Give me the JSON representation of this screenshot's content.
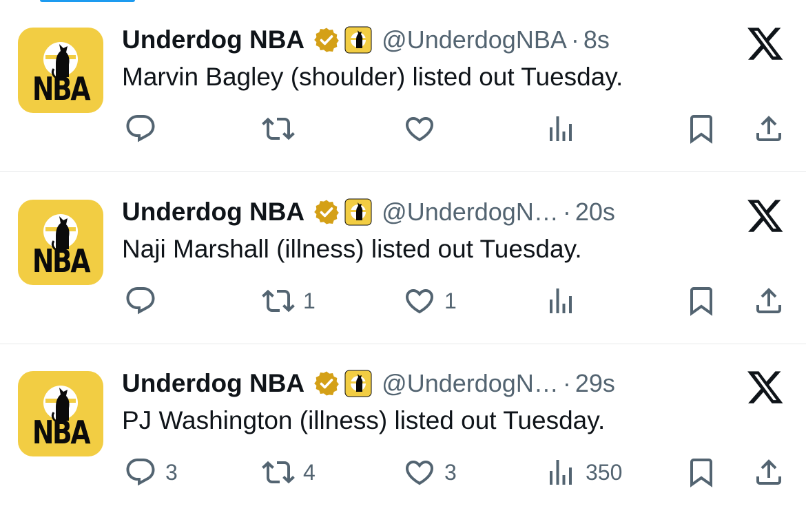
{
  "colors": {
    "verified": "#d4a017",
    "avatar_bg": "#f2cd43",
    "secondary": "#536471",
    "text": "#0f1419"
  },
  "tweets": [
    {
      "avatar_text": "NBA",
      "name": "Underdog NBA",
      "handle": "@UnderdogNBA",
      "separator": "·",
      "time": "8s",
      "text": "Marvin Bagley (shoulder) listed out Tuesday.",
      "counts": {
        "replies": "",
        "retweets": "",
        "likes": "",
        "views": ""
      }
    },
    {
      "avatar_text": "NBA",
      "name": "Underdog NBA",
      "handle": "@UnderdogN…",
      "separator": "·",
      "time": "20s",
      "text": "Naji Marshall (illness) listed out Tuesday.",
      "counts": {
        "replies": "",
        "retweets": "1",
        "likes": "1",
        "views": ""
      }
    },
    {
      "avatar_text": "NBA",
      "name": "Underdog NBA",
      "handle": "@UnderdogN…",
      "separator": "·",
      "time": "29s",
      "text": "PJ Washington (illness) listed out Tuesday.",
      "counts": {
        "replies": "3",
        "retweets": "4",
        "likes": "3",
        "views": "350"
      }
    }
  ]
}
